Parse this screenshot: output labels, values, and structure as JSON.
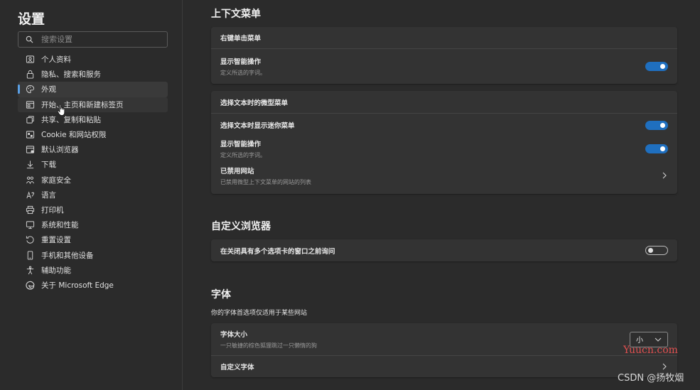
{
  "sidebar": {
    "title": "设置",
    "search_placeholder": "搜索设置",
    "items": [
      {
        "label": "个人资料",
        "icon": "profile-icon"
      },
      {
        "label": "隐私、搜索和服务",
        "icon": "lock-icon"
      },
      {
        "label": "外观",
        "icon": "palette-icon"
      },
      {
        "label": "开始、主页和新建标签页",
        "icon": "home-tabs-icon"
      },
      {
        "label": "共享、复制和粘贴",
        "icon": "share-icon"
      },
      {
        "label": "Cookie 和网站权限",
        "icon": "site-permissions-icon"
      },
      {
        "label": "默认浏览器",
        "icon": "browser-icon"
      },
      {
        "label": "下载",
        "icon": "download-icon"
      },
      {
        "label": "家庭安全",
        "icon": "family-icon"
      },
      {
        "label": "语言",
        "icon": "language-icon"
      },
      {
        "label": "打印机",
        "icon": "printer-icon"
      },
      {
        "label": "系统和性能",
        "icon": "system-icon"
      },
      {
        "label": "重置设置",
        "icon": "reset-icon"
      },
      {
        "label": "手机和其他设备",
        "icon": "phone-icon"
      },
      {
        "label": "辅助功能",
        "icon": "accessibility-icon"
      },
      {
        "label": "关于 Microsoft Edge",
        "icon": "edge-icon"
      }
    ]
  },
  "main": {
    "context_menu": {
      "title": "上下文菜单",
      "right_click_card": {
        "header": "右键单击菜单",
        "smart_actions_label": "显示智能操作",
        "smart_actions_desc": "定义所选的字词。",
        "smart_actions_on": true
      },
      "mini_menu_card": {
        "header": "选择文本时的微型菜单",
        "show_mini_menu_label": "选择文本时显示迷你菜单",
        "show_mini_menu_on": true,
        "smart_actions_label": "显示智能操作",
        "smart_actions_desc": "定义所选的字词。",
        "smart_actions_on": true,
        "disabled_sites_label": "已禁用网站",
        "disabled_sites_desc": "已禁用微型上下文菜单的网站的列表"
      }
    },
    "customize_browser": {
      "title": "自定义浏览器",
      "ask_before_close_label": "在关闭具有多个选项卡的窗口之前询问",
      "ask_before_close_on": false
    },
    "fonts": {
      "title": "字体",
      "note": "你的字体首选项仅适用于某些网站",
      "font_size_label": "字体大小",
      "font_size_desc": "一只敏捷的棕色狐狸跳过一只懒惰的狗",
      "font_size_value": "小",
      "custom_fonts_label": "自定义字体"
    }
  },
  "watermarks": {
    "site": "Yuucn.com",
    "credit": "CSDN @扬牧烟"
  },
  "colors": {
    "accent": "#1f6fbf",
    "background": "#2b2b2b",
    "card": "#333333",
    "watermark_red": "#e05050"
  }
}
